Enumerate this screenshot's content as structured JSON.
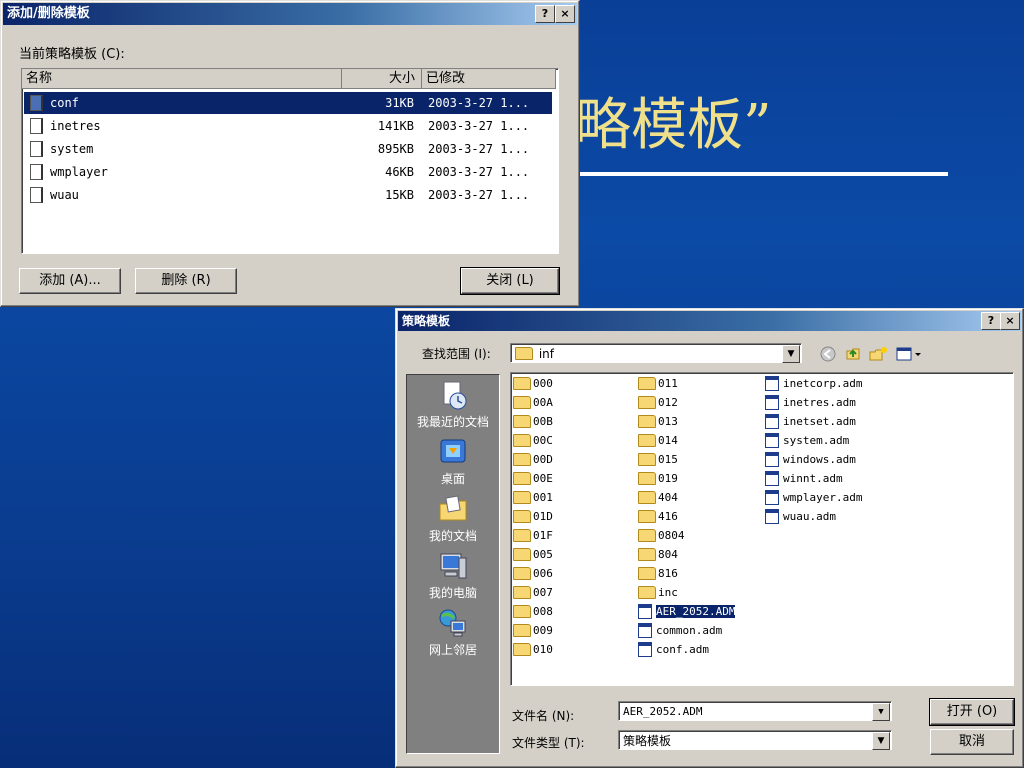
{
  "slide": {
    "title_fragment": "略模板”"
  },
  "dialog1": {
    "title": "添加/删除模板",
    "help_btn": "?",
    "close_btn": "×",
    "label": "当前策略模板 (C):",
    "columns": [
      "名称",
      "大小",
      "已修改"
    ],
    "rows": [
      {
        "name": "conf",
        "size": "31KB",
        "modified": "2003-3-27 1..."
      },
      {
        "name": "inetres",
        "size": "141KB",
        "modified": "2003-3-27 1..."
      },
      {
        "name": "system",
        "size": "895KB",
        "modified": "2003-3-27 1..."
      },
      {
        "name": "wmplayer",
        "size": "46KB",
        "modified": "2003-3-27 1..."
      },
      {
        "name": "wuau",
        "size": "15KB",
        "modified": "2003-3-27 1..."
      }
    ],
    "add_btn": "添加 (A)...",
    "delete_btn": "删除 (R)",
    "close_label": "关闭 (L)"
  },
  "dialog2": {
    "title": "策略模板",
    "help_btn": "?",
    "close_btn": "×",
    "lookin_label": "查找范围 (I):",
    "lookin_value": "inf",
    "places": [
      "我最近的文档",
      "桌面",
      "我的文档",
      "我的电脑",
      "网上邻居"
    ],
    "col1": [
      "000",
      "00A",
      "00B",
      "00C",
      "00D",
      "00E",
      "001",
      "01D",
      "01F",
      "005",
      "006",
      "007",
      "008",
      "009",
      "010"
    ],
    "col2": [
      "011",
      "012",
      "013",
      "014",
      "015",
      "019",
      "404",
      "416",
      "0804",
      "804",
      "816",
      "inc"
    ],
    "col2_files": [
      "AER_2052.ADM",
      "common.adm",
      "conf.adm"
    ],
    "col3": [
      "inetcorp.adm",
      "inetres.adm",
      "inetset.adm",
      "system.adm",
      "windows.adm",
      "winnt.adm",
      "wmplayer.adm",
      "wuau.adm"
    ],
    "filename_label": "文件名 (N):",
    "filename_value": "AER_2052.ADM",
    "filetype_label": "文件类型 (T):",
    "filetype_value": "策略模板",
    "open_btn": "打开 (O)",
    "cancel_btn": "取消"
  }
}
